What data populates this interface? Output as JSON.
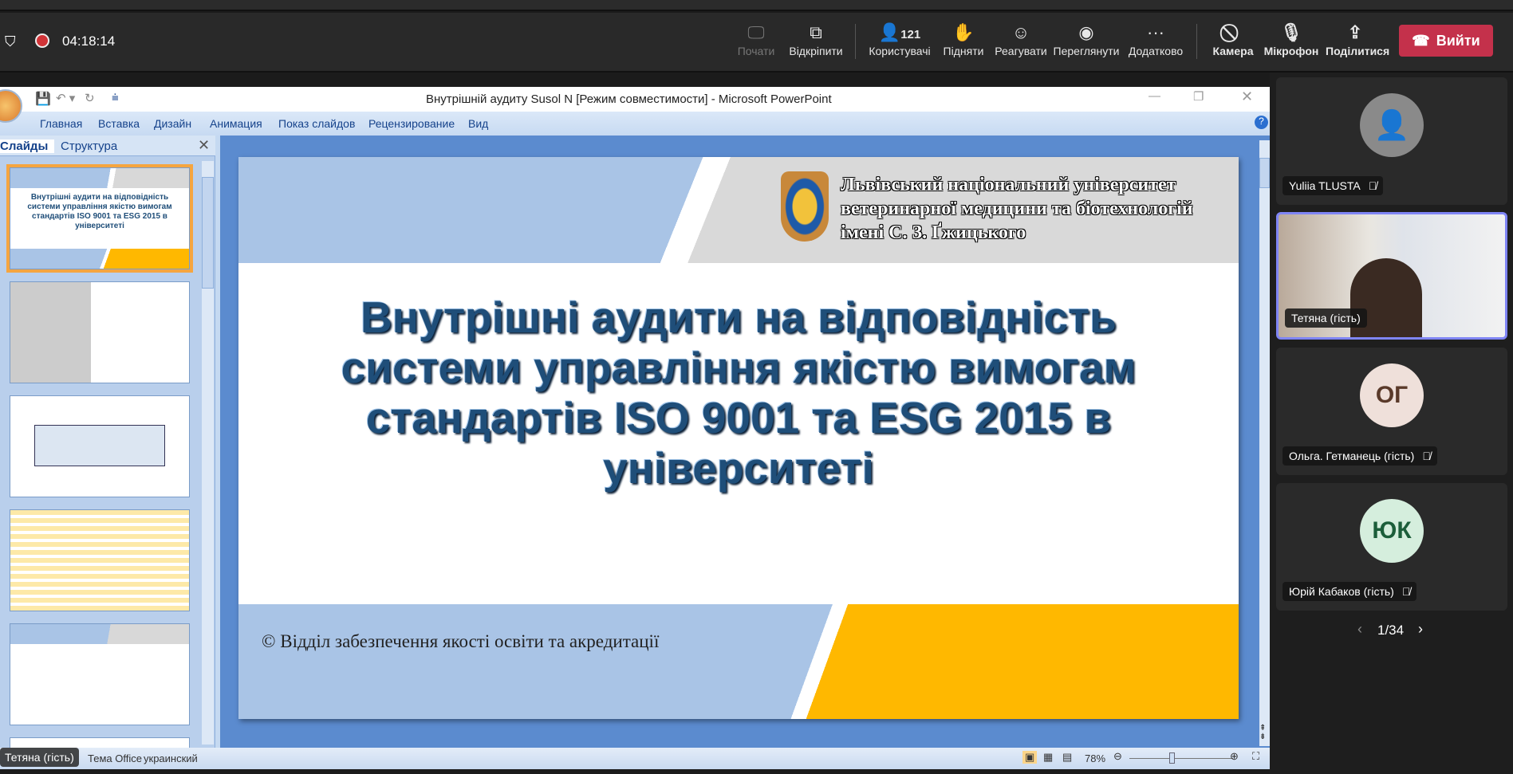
{
  "meeting": {
    "timer": "04:18:14",
    "toolbar": [
      {
        "id": "start",
        "label": "Почати",
        "icon": "screen-cursor-icon",
        "disabled": true
      },
      {
        "id": "popout",
        "label": "Відкріпити",
        "icon": "pop-out-icon"
      },
      {
        "id": "people",
        "label": "Користувачі",
        "icon": "people-icon",
        "count": "121"
      },
      {
        "id": "raise",
        "label": "Підняти",
        "icon": "raise-hand-icon"
      },
      {
        "id": "react",
        "label": "Реагувати",
        "icon": "smile-icon"
      },
      {
        "id": "view",
        "label": "Переглянути",
        "icon": "view-icon"
      },
      {
        "id": "more",
        "label": "Додатково",
        "icon": "more-icon"
      },
      {
        "id": "camera",
        "label": "Камера",
        "icon": "camera-off-icon"
      },
      {
        "id": "mic",
        "label": "Мікрофон",
        "icon": "mic-off-icon"
      },
      {
        "id": "share",
        "label": "Поділитися",
        "icon": "share-icon"
      }
    ],
    "leave_label": "Вийти",
    "participants": [
      {
        "name": "Yuliia TLUSTA",
        "initials": "",
        "muted": true
      },
      {
        "name": "Тетяна (гість)",
        "video": true,
        "muted": false
      },
      {
        "name": "Ольга. Гетманець (гість)",
        "initials": "ОГ",
        "muted": true
      },
      {
        "name": "Юрій Кабаков (гість)",
        "initials": "ЮК",
        "muted": true
      }
    ],
    "pager": "1/34",
    "presenter_label": "Тетяна (гість)"
  },
  "ppt": {
    "title": "Внутрішній  аудиту Susol N [Режим совместимости] - Microsoft PowerPoint",
    "tabs": [
      "Главная",
      "Вставка",
      "Дизайн",
      "Анимация",
      "Показ слайдов",
      "Рецензирование",
      "Вид"
    ],
    "panel_tabs": [
      "Слайды",
      "Структура"
    ],
    "slide": {
      "university": [
        "Львівський національний університет",
        "ветеринарної медицини та біотехнологій",
        "імені С. З. Ґжицького"
      ],
      "title_lines": [
        "Внутрішні аудити на відповідність",
        "системи управління якістю вимогам",
        "стандартів ISO 9001 та ESG 2015 в",
        "університеті"
      ],
      "footer": "© Відділ забезпечення якості освіти та акредитації"
    },
    "status": {
      "theme": "Тема Office",
      "language": "украинский",
      "zoom": "78%"
    },
    "colors": {
      "accent_orange": "#FFB800",
      "slide_blue": "#A9C4E6",
      "title_blue": "#1F4E79"
    }
  }
}
